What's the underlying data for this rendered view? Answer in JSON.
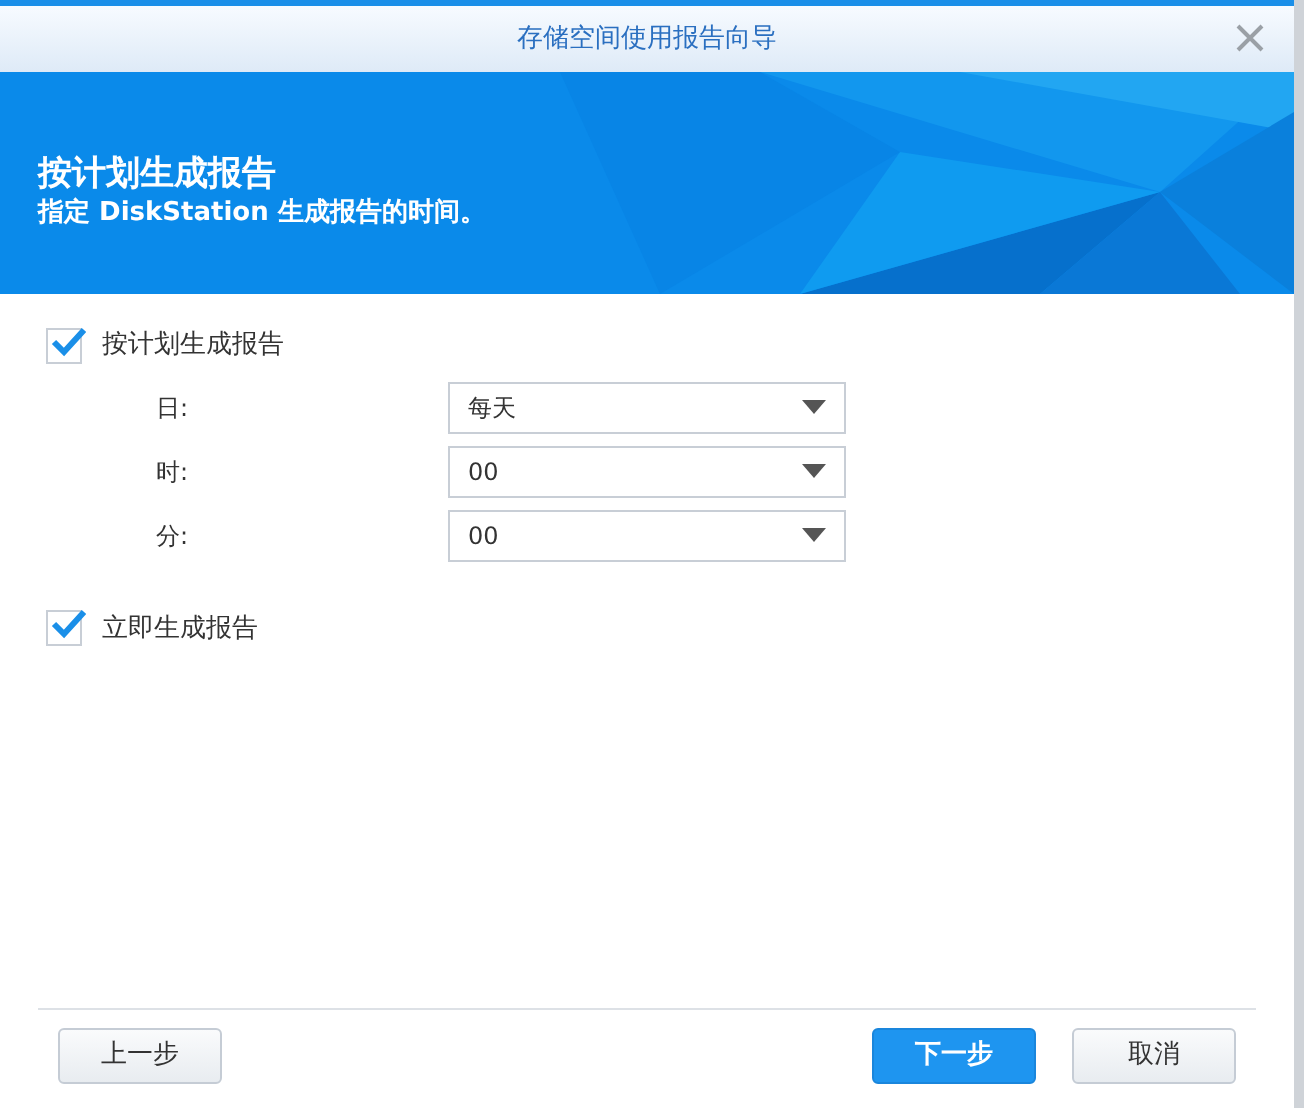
{
  "window": {
    "title": "存储空间使用报告向导"
  },
  "header": {
    "title": "按计划生成报告",
    "subtitle": "指定 DiskStation 生成报告的时间。"
  },
  "schedule": {
    "label": "按计划生成报告",
    "checked": true,
    "fields": [
      {
        "label": "日:",
        "value": "每天"
      },
      {
        "label": "时:",
        "value": "00"
      },
      {
        "label": "分:",
        "value": "00"
      }
    ]
  },
  "immediate": {
    "label": "立即生成报告",
    "checked": true
  },
  "buttons": [
    {
      "label": "上一步",
      "kind": "default"
    },
    {
      "label": "下一步",
      "kind": "primary"
    },
    {
      "label": "取消",
      "kind": "default"
    }
  ]
}
